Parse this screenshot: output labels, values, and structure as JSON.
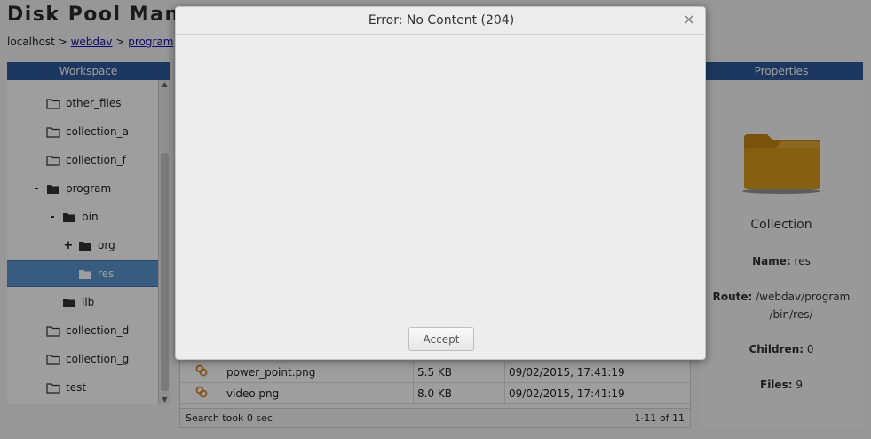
{
  "app": {
    "title": "Disk Pool Manag"
  },
  "breadcrumb": {
    "host": "localhost",
    "sep": ">",
    "part1": "webdav",
    "part2": "program",
    "trail": ">"
  },
  "workspace": {
    "header": "Workspace",
    "items": [
      {
        "label": "other_files",
        "toggle": ""
      },
      {
        "label": "collection_a",
        "toggle": ""
      },
      {
        "label": "collection_f",
        "toggle": ""
      },
      {
        "label": "program",
        "toggle": "-"
      },
      {
        "label": "bin",
        "toggle": "-"
      },
      {
        "label": "org",
        "toggle": "+"
      },
      {
        "label": "res",
        "toggle": ""
      },
      {
        "label": "lib",
        "toggle": ""
      },
      {
        "label": "collection_d",
        "toggle": ""
      },
      {
        "label": "collection_g",
        "toggle": ""
      },
      {
        "label": "test",
        "toggle": ""
      }
    ]
  },
  "files": {
    "rows": [
      {
        "name": "power_point.png",
        "size": "5.5 KB",
        "date": "09/02/2015, 17:41:19"
      },
      {
        "name": "video.png",
        "size": "8.0 KB",
        "date": "09/02/2015, 17:41:19"
      }
    ],
    "footer_left": "Search took 0 sec",
    "footer_right": "1-11 of 11"
  },
  "properties": {
    "header": "Properties",
    "type": "Collection",
    "name_label": "Name:",
    "name_value": "res",
    "route_label": "Route:",
    "route_value_line1": "/webdav/program",
    "route_value_line2": "/bin/res/",
    "children_label": "Children:",
    "children_value": "0",
    "files_label": "Files:",
    "files_value": "9"
  },
  "dialog": {
    "title": "Error: No Content (204)",
    "close_symbol": "×",
    "accept_label": "Accept"
  },
  "colors": {
    "header_blue": "#2f5b9c",
    "selection_blue": "#5b93cf",
    "folder_gold": "#d99a1c"
  }
}
